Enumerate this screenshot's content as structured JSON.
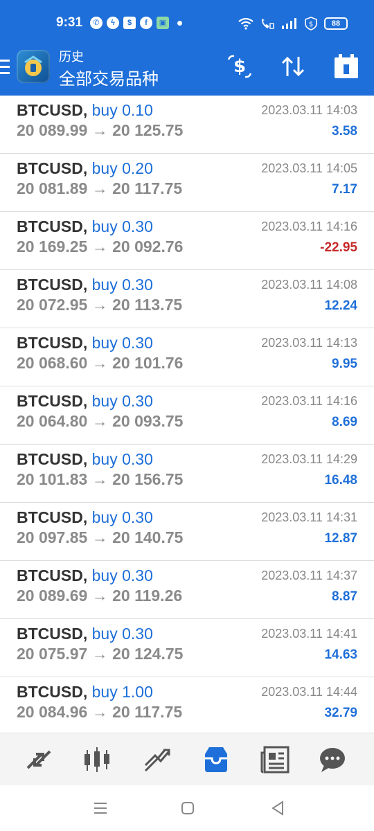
{
  "status_bar": {
    "time": "9:31",
    "battery": "88",
    "notification_icons": [
      "whatsapp-icon",
      "messenger-icon",
      "shop-icon",
      "facebook-icon",
      "store-icon",
      "dot-icon"
    ],
    "system_icons": [
      "wifi-icon",
      "call-icon",
      "signal-icon",
      "money-icon",
      "battery-icon"
    ]
  },
  "header": {
    "subtitle": "历史",
    "title": "全部交易品种",
    "actions": [
      "dollar-exchange-icon",
      "sort-icon",
      "calendar-icon"
    ]
  },
  "trades": [
    {
      "symbol": "BTCUSD,",
      "side": "buy 0.10",
      "prices": "20 089.99 → 20 125.75",
      "time": "2023.03.11 14:03",
      "profit": "3.58",
      "negative": false
    },
    {
      "symbol": "BTCUSD,",
      "side": "buy 0.20",
      "prices": "20 081.89 → 20 117.75",
      "time": "2023.03.11 14:05",
      "profit": "7.17",
      "negative": false
    },
    {
      "symbol": "BTCUSD,",
      "side": "buy 0.30",
      "prices": "20 169.25 → 20 092.76",
      "time": "2023.03.11 14:16",
      "profit": "-22.95",
      "negative": true
    },
    {
      "symbol": "BTCUSD,",
      "side": "buy 0.30",
      "prices": "20 072.95 → 20 113.75",
      "time": "2023.03.11 14:08",
      "profit": "12.24",
      "negative": false
    },
    {
      "symbol": "BTCUSD,",
      "side": "buy 0.30",
      "prices": "20 068.60 → 20 101.76",
      "time": "2023.03.11 14:13",
      "profit": "9.95",
      "negative": false
    },
    {
      "symbol": "BTCUSD,",
      "side": "buy 0.30",
      "prices": "20 064.80 → 20 093.75",
      "time": "2023.03.11 14:16",
      "profit": "8.69",
      "negative": false
    },
    {
      "symbol": "BTCUSD,",
      "side": "buy 0.30",
      "prices": "20 101.83 → 20 156.75",
      "time": "2023.03.11 14:29",
      "profit": "16.48",
      "negative": false
    },
    {
      "symbol": "BTCUSD,",
      "side": "buy 0.30",
      "prices": "20 097.85 → 20 140.75",
      "time": "2023.03.11 14:31",
      "profit": "12.87",
      "negative": false
    },
    {
      "symbol": "BTCUSD,",
      "side": "buy 0.30",
      "prices": "20 089.69 → 20 119.26",
      "time": "2023.03.11 14:37",
      "profit": "8.87",
      "negative": false
    },
    {
      "symbol": "BTCUSD,",
      "side": "buy 0.30",
      "prices": "20 075.97 → 20 124.75",
      "time": "2023.03.11 14:41",
      "profit": "14.63",
      "negative": false
    },
    {
      "symbol": "BTCUSD,",
      "side": "buy 1.00",
      "prices": "20 084.96 → 20 117.75",
      "time": "2023.03.11 14:44",
      "profit": "32.79",
      "negative": false
    }
  ],
  "bottom_nav": {
    "items": [
      "quotes-icon",
      "chart-icon",
      "trade-icon",
      "history-icon",
      "news-icon",
      "chat-icon"
    ],
    "active": "history-icon"
  },
  "colors": {
    "accent": "#1e6fd9",
    "negative": "#c62828",
    "muted": "#8a8a8a"
  }
}
